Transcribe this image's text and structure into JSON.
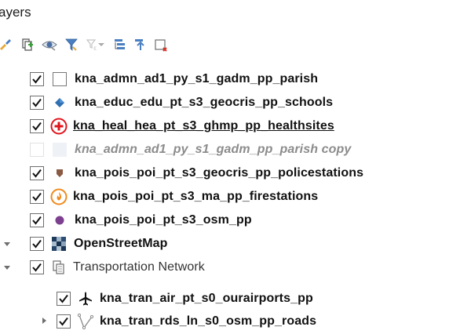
{
  "panel": {
    "title": "ayers"
  },
  "toolbar": {
    "icons": [
      "style-brush-icon",
      "add-group-icon",
      "manage-visibility-icon",
      "filter-legend-icon",
      "filter-expression-icon",
      "dropdown-icon",
      "expand-all-icon",
      "collapse-all-icon",
      "remove-layer-icon"
    ]
  },
  "layers": [
    {
      "label": "kna_admn_ad1_py_s1_gadm_pp_parish",
      "checked": true,
      "symbol": "polygon-white"
    },
    {
      "label": "kna_educ_edu_pt_s3_geocris_pp_schools",
      "checked": true,
      "symbol": "blue-diamond"
    },
    {
      "label": "kna_heal_hea_pt_s3_ghmp_pp_healthsites",
      "checked": true,
      "symbol": "red-cross"
    },
    {
      "label": "kna_admn_ad1_py_s1_gadm_pp_parish copy",
      "checked": false,
      "symbol": "polygon-faded"
    },
    {
      "label": "kna_pois_poi_pt_s3_geocris_pp_policestations",
      "checked": true,
      "symbol": "brown-shield"
    },
    {
      "label": "kna_pois_poi_pt_s3_ma_pp_firestations",
      "checked": true,
      "symbol": "fire"
    },
    {
      "label": "kna_pois_poi_pt_s3_osm_pp",
      "checked": true,
      "symbol": "purple-dot"
    },
    {
      "label": "OpenStreetMap",
      "checked": true,
      "symbol": "raster-tiles",
      "expanded": true
    },
    {
      "label": "Transportation Network",
      "checked": true,
      "symbol": "group",
      "expanded": true
    },
    {
      "label": "kna_tran_air_pt_s0_ourairports_pp",
      "checked": true,
      "symbol": "airplane"
    },
    {
      "label": "kna_tran_rds_ln_s0_osm_pp_roads",
      "checked": true,
      "symbol": "line",
      "expanded": false
    }
  ]
}
